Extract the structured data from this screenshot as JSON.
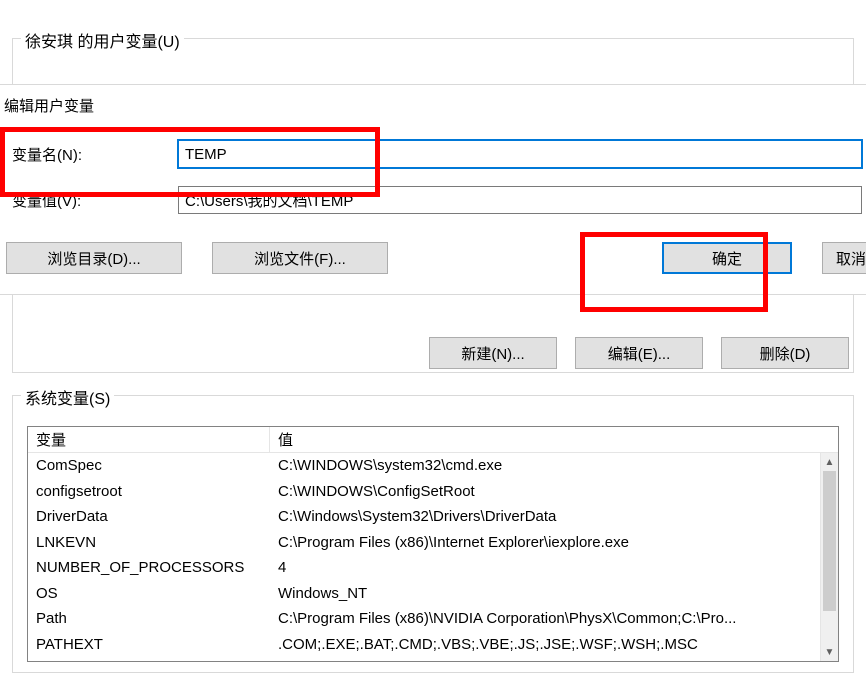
{
  "parent": {
    "user_gb_label": "徐安琪 的用户变量(U)",
    "sys_gb_label": "系统变量(S)",
    "buttons": {
      "new": "新建(N)...",
      "edit": "编辑(E)...",
      "delete": "删除(D)"
    },
    "table": {
      "col_name": "变量",
      "col_value": "值",
      "rows": [
        {
          "name": "ComSpec",
          "value": "C:\\WINDOWS\\system32\\cmd.exe"
        },
        {
          "name": "configsetroot",
          "value": "C:\\WINDOWS\\ConfigSetRoot"
        },
        {
          "name": "DriverData",
          "value": "C:\\Windows\\System32\\Drivers\\DriverData"
        },
        {
          "name": "LNKEVN",
          "value": "C:\\Program Files (x86)\\Internet Explorer\\iexplore.exe"
        },
        {
          "name": "NUMBER_OF_PROCESSORS",
          "value": "4"
        },
        {
          "name": "OS",
          "value": "Windows_NT"
        },
        {
          "name": "Path",
          "value": "C:\\Program Files (x86)\\NVIDIA Corporation\\PhysX\\Common;C:\\Pro..."
        },
        {
          "name": "PATHEXT",
          "value": ".COM;.EXE;.BAT;.CMD;.VBS;.VBE;.JS;.JSE;.WSF;.WSH;.MSC"
        }
      ]
    }
  },
  "edit": {
    "title": "编辑用户变量",
    "name_label": "变量名(N):",
    "value_label": "变量值(V):",
    "name_value": "TEMP",
    "value_value": "C:\\Users\\我的文档\\TEMP",
    "buttons": {
      "browse_dir": "浏览目录(D)...",
      "browse_file": "浏览文件(F)...",
      "ok": "确定",
      "cancel": "取消"
    }
  },
  "annotation": {
    "color": "#ff0000"
  }
}
